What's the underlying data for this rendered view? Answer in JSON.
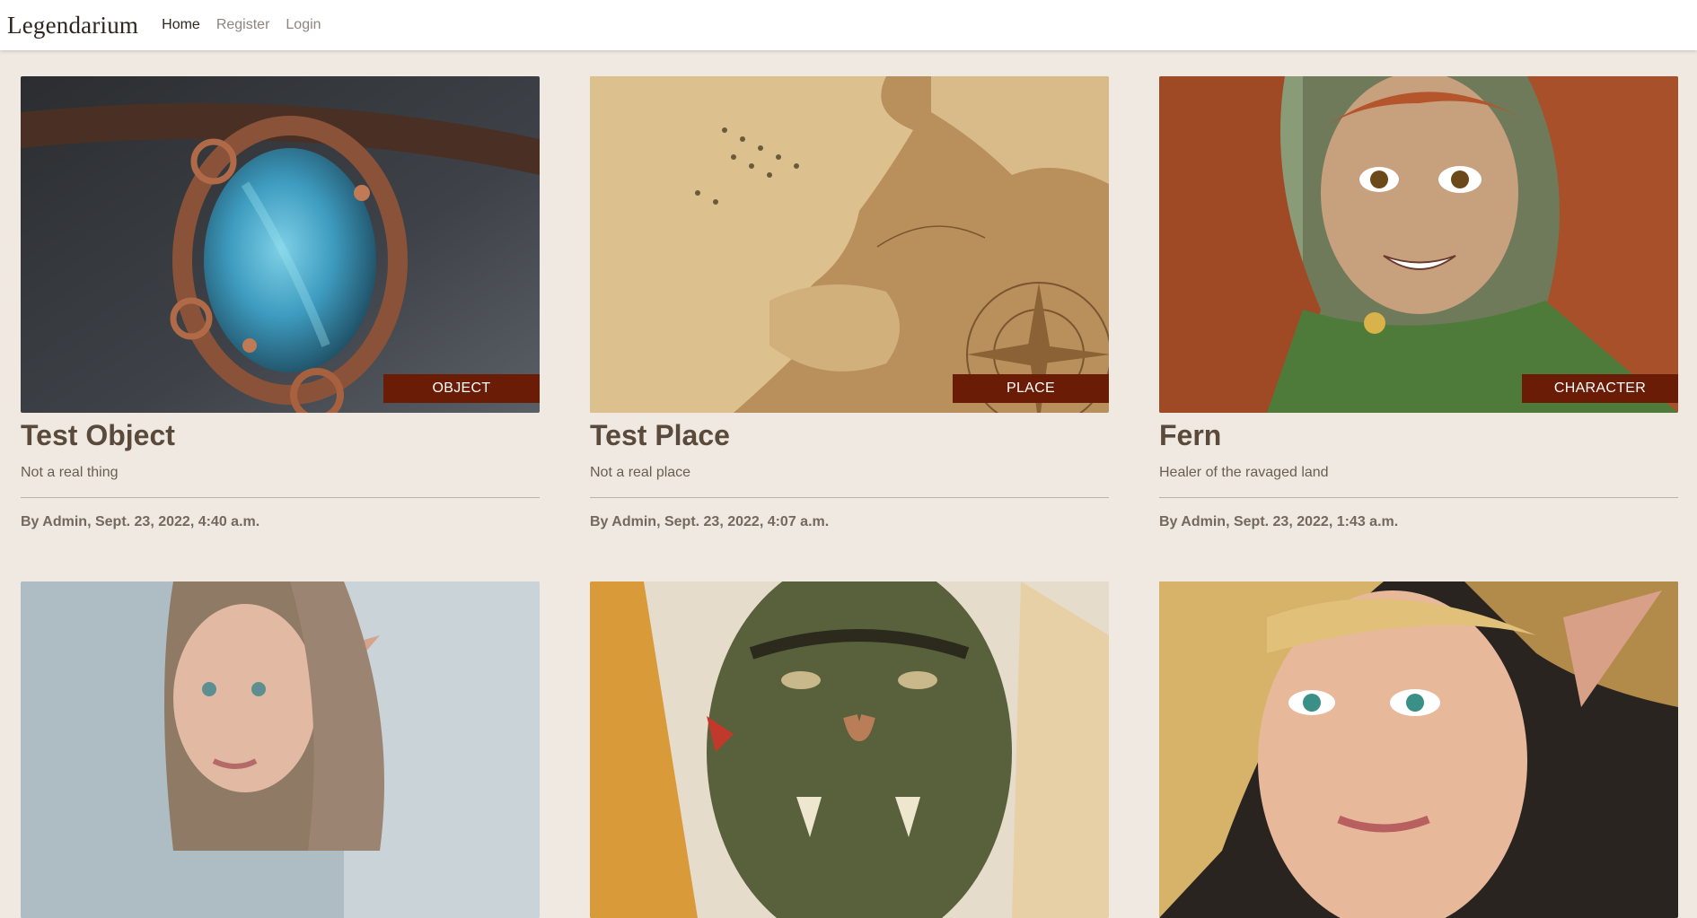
{
  "site": {
    "brand": "Legendarium",
    "nav": [
      {
        "label": "Home",
        "active": true
      },
      {
        "label": "Register",
        "active": false
      },
      {
        "label": "Login",
        "active": false
      }
    ]
  },
  "cards": [
    {
      "title": "Test Object",
      "subtitle": "Not a real thing",
      "tag": "OBJECT",
      "meta": "By Admin, Sept. 23, 2022, 4:40 a.m.",
      "image": "pendant-image"
    },
    {
      "title": "Test Place",
      "subtitle": "Not a real place",
      "tag": "PLACE",
      "meta": "By Admin, Sept. 23, 2022, 4:07 a.m.",
      "image": "map-image"
    },
    {
      "title": "Fern",
      "subtitle": "Healer of the ravaged land",
      "tag": "CHARACTER",
      "meta": "By Admin, Sept. 23, 2022, 1:43 a.m.",
      "image": "fern-portrait-image"
    },
    {
      "image": "elf-woman-portrait-image"
    },
    {
      "image": "orc-portrait-image"
    },
    {
      "image": "blonde-elf-portrait-image"
    }
  ],
  "colors": {
    "background": "#efe9e1",
    "tag_background": "#6b1c07",
    "title_text": "#5a4a3c"
  }
}
